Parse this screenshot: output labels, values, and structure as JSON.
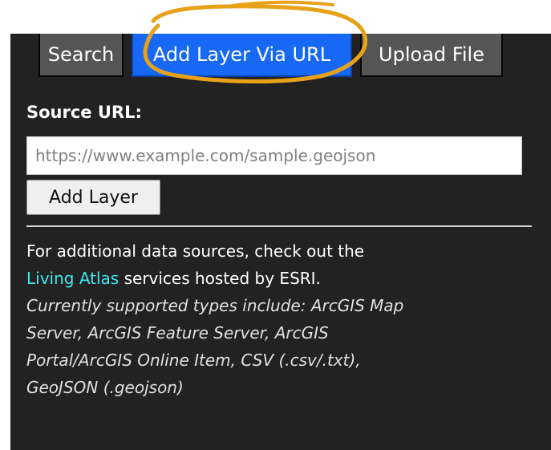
{
  "tabs": {
    "search": "Search",
    "add_layer_via_url": "Add Layer Via URL",
    "upload_file": "Upload File",
    "active": "Add Layer Via URL"
  },
  "form": {
    "source_label": "Source URL:",
    "url_placeholder": "https://www.example.com/sample.geojson",
    "url_value": "",
    "add_button_label": "Add Layer"
  },
  "info": {
    "line_1": "For additional data sources, check out the",
    "atlas_link": "Living Atlas",
    "line_2_rest": " services hosted by ESRI.",
    "supported_lines": [
      "Currently supported types include: ArcGIS Map",
      "Server, ArcGIS Feature Server, ArcGIS",
      "Portal/ArcGIS Online Item, CSV (.csv/.txt),",
      "GeoJSON (.geojson)"
    ]
  },
  "annotation": {
    "shape": "ellipse-highlight",
    "target": "Add Layer Via URL",
    "color": "#e8a21a"
  },
  "colors": {
    "panel_bg": "#222222",
    "active_tab": "#1769f5",
    "inactive_tab": "#555555",
    "link": "#3ee7ef"
  }
}
